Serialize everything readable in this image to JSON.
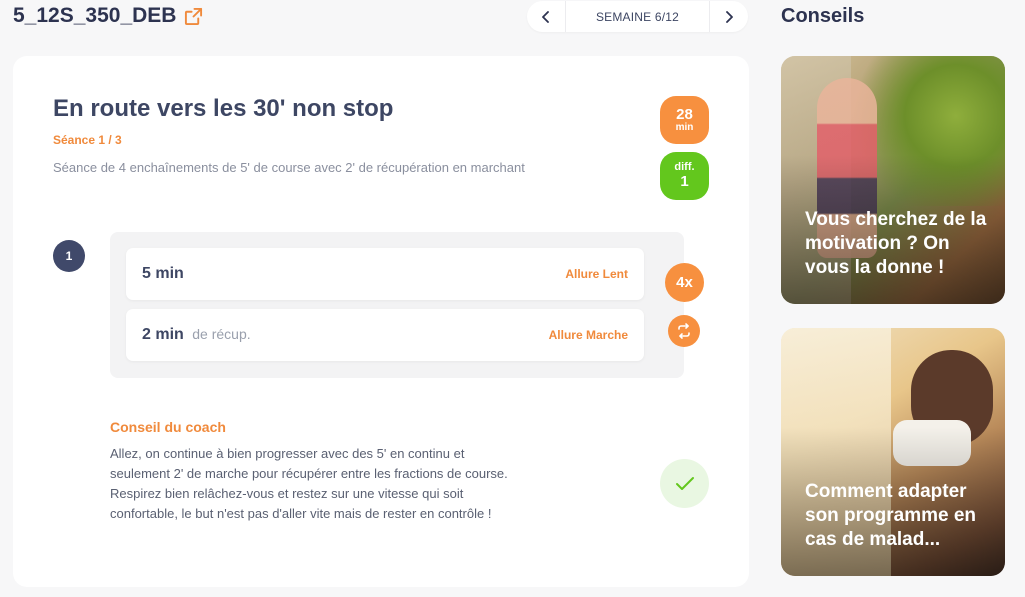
{
  "header": {
    "program_title": "5_12S_350_DEB",
    "external_link_icon": "external-link-icon",
    "week_label": "SEMAINE 6/12",
    "prev_icon": "chevron-left-icon",
    "next_icon": "chevron-right-icon"
  },
  "session": {
    "title": "En route vers les 30' non stop",
    "count": "Séance 1 / 3",
    "description": "Séance de 4 enchaînements de 5' de course avec 2' de récupération en marchant",
    "duration_value": "28",
    "duration_unit": "min",
    "difficulty_label": "diff.",
    "difficulty_value": "1"
  },
  "steps": [
    {
      "number": "1",
      "repeat": "4x",
      "loop_icon": "loop-icon",
      "intervals": [
        {
          "duration": "5 min",
          "suffix": "",
          "pace": "Allure Lent"
        },
        {
          "duration": "2 min",
          "suffix": "de récup.",
          "pace": "Allure Marche"
        }
      ]
    }
  ],
  "coach": {
    "title": "Conseil du coach",
    "lines": [
      "Allez, on continue à bien progresser avec des 5' en continu et",
      "seulement 2' de marche pour récupérer entre les fractions de course.",
      "Respirez bien relâchez-vous et restez sur une vitesse qui soit",
      "confortable, le but n'est pas d'aller vite mais de rester en contrôle !"
    ],
    "done_icon": "check-icon"
  },
  "tips": {
    "title": "Conseils",
    "cards": [
      {
        "caption": "Vous cherchez de la motivation ? On vous la donne !"
      },
      {
        "caption": "Comment adapter son programme en cas de malad..."
      }
    ]
  },
  "colors": {
    "accent_orange": "#f7903f",
    "difficulty_green": "#63c71d",
    "dark_navy": "#3d4663"
  }
}
